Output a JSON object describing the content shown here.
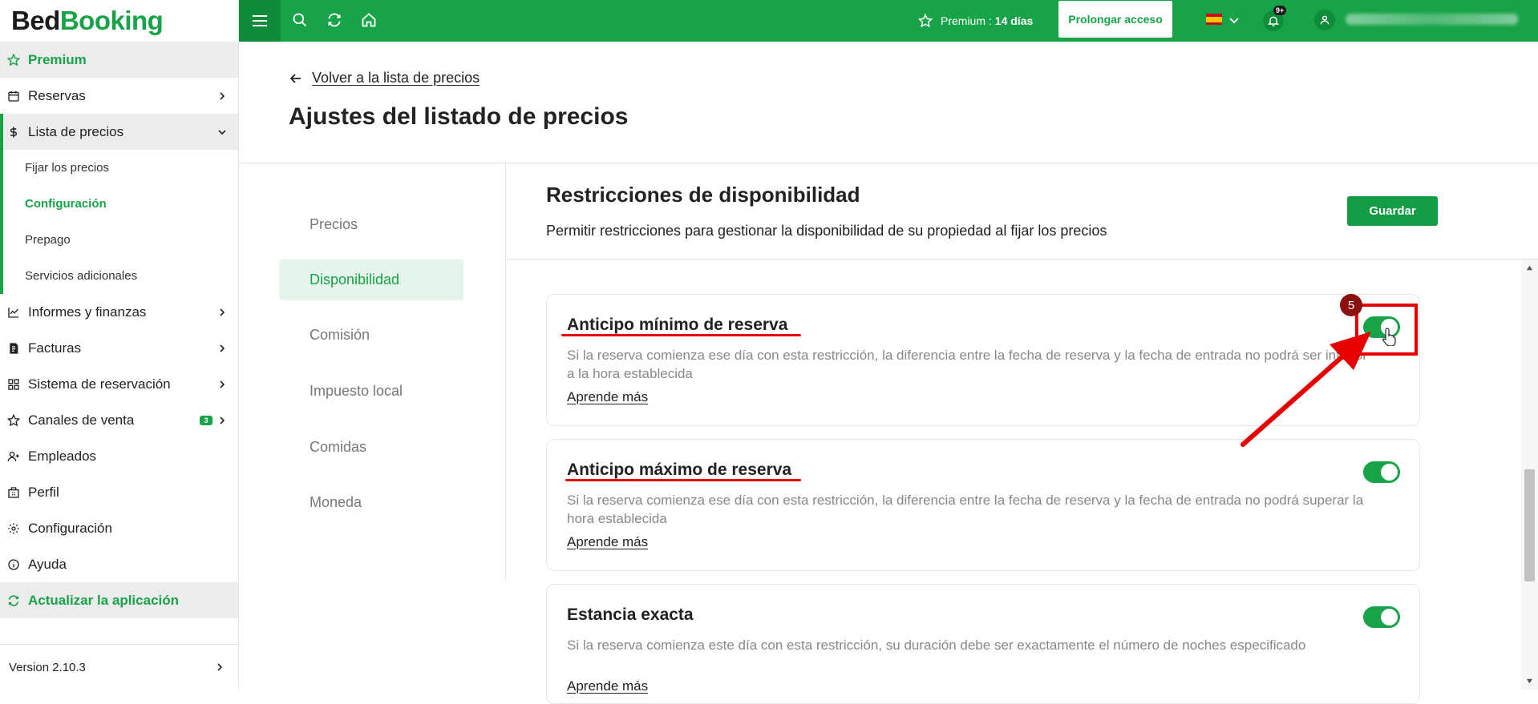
{
  "app": {
    "logo_part1": "Bed",
    "logo_part2": "Booking"
  },
  "sidebar": {
    "premium_label": "Premium",
    "items": [
      {
        "label": "Reservas"
      },
      {
        "label": "Lista de precios"
      },
      {
        "label": "Informes y finanzas"
      },
      {
        "label": "Facturas"
      },
      {
        "label": "Sistema de reservación"
      },
      {
        "label": "Canales de venta",
        "badge": "3"
      },
      {
        "label": "Empleados"
      },
      {
        "label": "Perfil"
      },
      {
        "label": "Configuración"
      },
      {
        "label": "Ayuda"
      }
    ],
    "subitems": [
      {
        "label": "Fijar los precios"
      },
      {
        "label": "Configuración"
      },
      {
        "label": "Prepago"
      },
      {
        "label": "Servicios adicionales"
      }
    ],
    "update_label": "Actualizar la aplicación",
    "version": "Version 2.10.3"
  },
  "topbar": {
    "premium_prefix": "Premium :",
    "premium_days": "14 días",
    "prolong_label": "Prolongar acceso",
    "notif_badge": "9+",
    "accent": "#18a349"
  },
  "page": {
    "back_label": "Volver a la lista de precios",
    "title": "Ajustes del listado de precios"
  },
  "tabs": [
    {
      "label": "Precios"
    },
    {
      "label": "Disponibilidad"
    },
    {
      "label": "Comisión"
    },
    {
      "label": "Impuesto local"
    },
    {
      "label": "Comidas"
    },
    {
      "label": "Moneda"
    }
  ],
  "section": {
    "title": "Restricciones de disponibilidad",
    "description": "Permitir restricciones para gestionar la disponibilidad de su propiedad al fijar los precios",
    "save_label": "Guardar"
  },
  "cards": [
    {
      "title": "Anticipo mínimo de reserva",
      "description": "Si la reserva comienza ese día con esta restricción, la diferencia entre la fecha de reserva y la fecha de entrada no podrá ser inferior a la hora establecida",
      "learn": "Aprende más",
      "enabled": true
    },
    {
      "title": "Anticipo máximo de reserva",
      "description": "Si la reserva comienza ese día con esta restricción, la diferencia entre la fecha de reserva y la fecha de entrada no podrá superar la hora establecida",
      "learn": "Aprende más",
      "enabled": true
    },
    {
      "title": "Estancia exacta",
      "description": "Si la reserva comienza este día con esta restricción, su duración debe ser exactamente el número de noches especificado",
      "learn": "Aprende más",
      "enabled": true
    }
  ],
  "annotation": {
    "step_number": "5"
  }
}
